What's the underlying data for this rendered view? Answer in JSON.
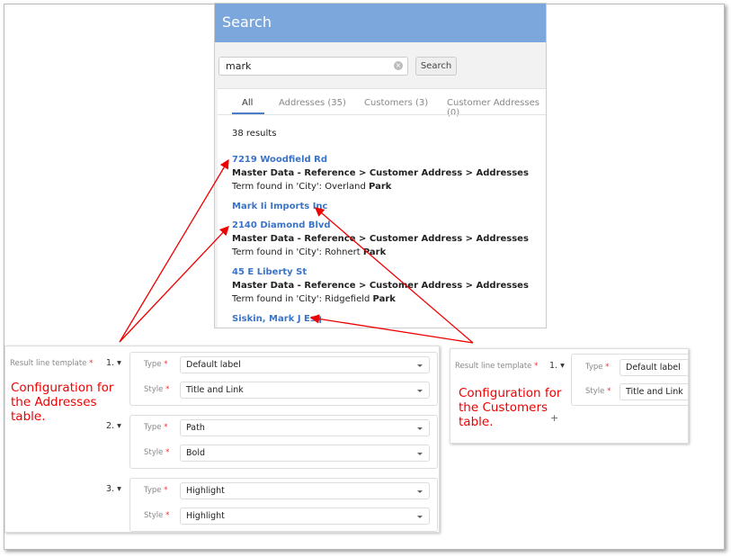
{
  "search": {
    "title": "Search",
    "query": "mark",
    "search_button": "Search",
    "tabs": [
      {
        "label": "All"
      },
      {
        "label": "Addresses (35)"
      },
      {
        "label": "Customers (3)"
      },
      {
        "label": "Customer Addresses (0)"
      }
    ],
    "count": "38 results",
    "results": [
      {
        "title": "7219 Woodfield Rd",
        "path": "Master Data - Reference > Customer Address > Addresses",
        "term_prefix": "Term found in 'City': Overland ",
        "term_bold": "Park"
      },
      {
        "title": "Mark Ii Imports Inc"
      },
      {
        "title": "2140 Diamond Blvd",
        "path": "Master Data - Reference > Customer Address > Addresses",
        "term_prefix": "Term found in 'City': Rohnert ",
        "term_bold": "Park"
      },
      {
        "title": "45 E Liberty St",
        "path": "Master Data - Reference > Customer Address > Addresses",
        "term_prefix": "Term found in 'City': Ridgefield ",
        "term_bold": "Park"
      },
      {
        "title": "Siskin, Mark J Esq"
      }
    ]
  },
  "addresses_config": {
    "label": "Result line template",
    "required": "*",
    "note": "Configuration for the Addresses table.",
    "groups": [
      {
        "num": "1.",
        "type": "Default label",
        "style": "Title and Link"
      },
      {
        "num": "2.",
        "type": "Path",
        "style": "Bold"
      },
      {
        "num": "3.",
        "type": "Highlight",
        "style": "Highlight"
      }
    ],
    "type_label": "Type",
    "style_label": "Style"
  },
  "customers_config": {
    "label": "Result line template",
    "required": "*",
    "note": "Configuration for the Customers table.",
    "add": "+",
    "groups": [
      {
        "num": "1.",
        "type": "Default label",
        "style": "Title and Link"
      }
    ],
    "type_label": "Type",
    "style_label": "Style"
  },
  "colors": {
    "header": "#7ba7dc",
    "link": "#3a73c8",
    "annotation": "#e00000"
  }
}
